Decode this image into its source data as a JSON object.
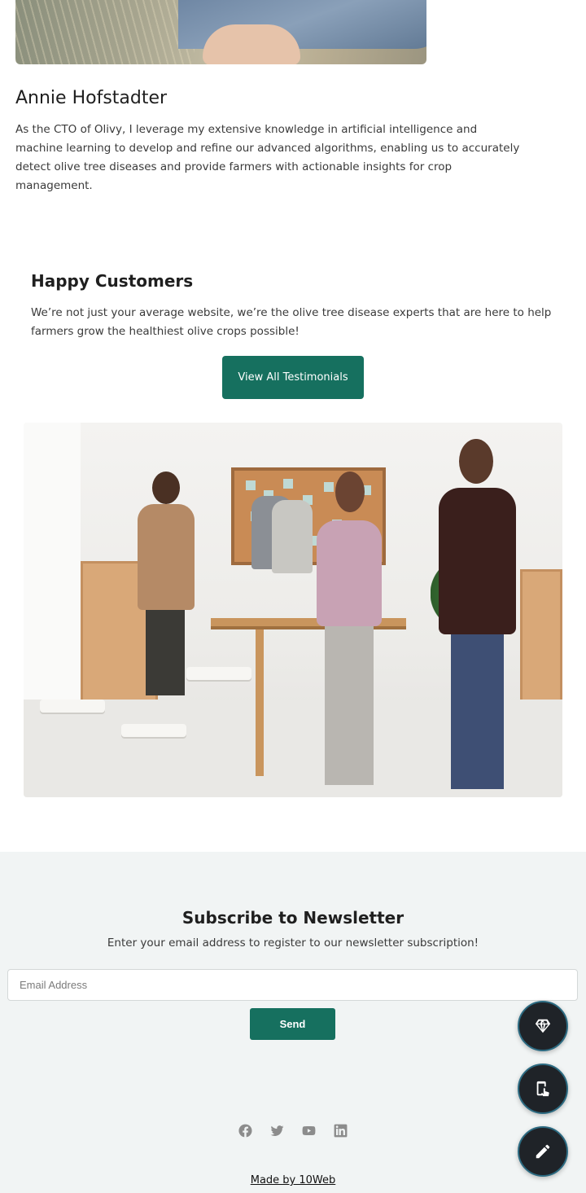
{
  "profile": {
    "name": "Annie Hofstadter",
    "bio": "As the CTO of Olivy, I leverage my extensive knowledge in artificial intelligence and machine learning to develop and refine our advanced algorithms, enabling us to accurately detect olive tree diseases and provide farmers with actionable insights for crop management."
  },
  "testimonials": {
    "title": "Happy Customers",
    "text": "We’re not just your average website, we’re the olive tree disease experts that are here to help farmers grow the healthiest olive crops possible!",
    "button_label": "View All Testimonials"
  },
  "newsletter": {
    "title": "Subscribe to Newsletter",
    "subtitle": "Enter your email address to register  to  our newsletter subscription!",
    "email_placeholder": "Email Address",
    "send_label": "Send"
  },
  "social": {
    "icons": [
      "facebook-icon",
      "twitter-icon",
      "youtube-icon",
      "linkedin-icon"
    ]
  },
  "footer": {
    "made_by": "Made by 10Web"
  },
  "floating_actions": {
    "icons": [
      "diamond-icon",
      "mobile-touch-icon",
      "pencil-icon"
    ]
  },
  "colors": {
    "accent": "#16705f",
    "newsletter_bg": "#f1f4f4",
    "fab_bg": "#1f2328"
  }
}
